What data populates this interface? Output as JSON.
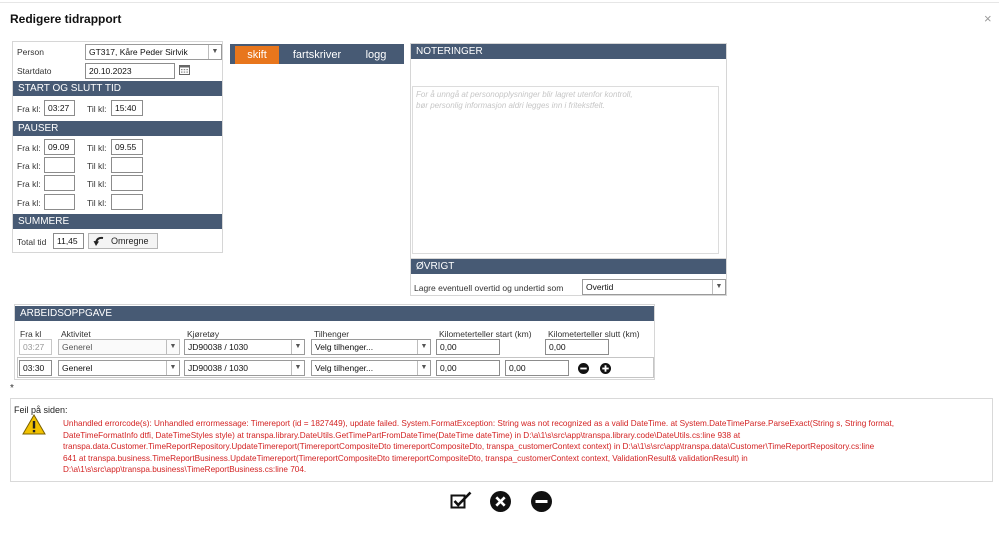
{
  "dialog": {
    "title": "Redigere tidrapport",
    "close_glyph": "×"
  },
  "person": {
    "label": "Person",
    "value": "GT317, Kåre Peder Sirlvik",
    "startdato_label": "Startdato",
    "startdato_value": "20.10.2023"
  },
  "start_slutt": {
    "header": "START OG SLUTT TID",
    "fra_label": "Fra kl:",
    "fra_value": "03:27",
    "til_label": "Til kl:",
    "til_value": "15:40"
  },
  "pauser": {
    "header": "PAUSER",
    "rows": [
      {
        "fra_label": "Fra kl:",
        "fra": "09.09",
        "til_label": "Til kl:",
        "til": "09.55"
      },
      {
        "fra_label": "Fra kl:",
        "fra": "",
        "til_label": "Til kl:",
        "til": ""
      },
      {
        "fra_label": "Fra kl:",
        "fra": "",
        "til_label": "Til kl:",
        "til": ""
      },
      {
        "fra_label": "Fra kl:",
        "fra": "",
        "til_label": "Til kl:",
        "til": ""
      }
    ]
  },
  "summere": {
    "header": "SUMMERE",
    "total_label": "Total tid",
    "total_value": "11,45",
    "omregne_label": "Omregne"
  },
  "tabs": [
    {
      "label": "skift",
      "active": true
    },
    {
      "label": "fartskriver",
      "active": false
    },
    {
      "label": "logg",
      "active": false
    }
  ],
  "noteringer": {
    "header": "NOTERINGER",
    "placeholder_line1": "For å unngå at personopplysninger blir lagret utenfor kontroll,",
    "placeholder_line2": "bør personlig informasjon aldri legges inn i fritekstfelt."
  },
  "ovrigt": {
    "header": "ØVRIGT",
    "label": "Lagre eventuell overtid og undertid som",
    "value": "Overtid"
  },
  "arbeid": {
    "header": "ARBEIDSOPPGAVE",
    "columns": [
      "Fra kl",
      "Aktivitet",
      "Kjøretøy",
      "Tilhenger",
      "Kilometerteller start (km)",
      "Kilometerteller slutt (km)"
    ],
    "row1": {
      "fra": "03:27",
      "aktivitet": "Generel",
      "kjoretoy": "JD90038 / 1030",
      "tilhenger": "Velg tilhenger...",
      "km_start": "0,00",
      "km_slutt": "0,00"
    },
    "row2": {
      "fra": "03:30",
      "aktivitet": "Generel",
      "kjoretoy": "JD90038 / 1030",
      "tilhenger": "Velg tilhenger...",
      "km_start": "0,00",
      "km_slutt": "0,00"
    }
  },
  "asterisk": "*",
  "error": {
    "title": "Feil på siden:",
    "lines": [
      "Unhandled errorcode(s): Unhandled errormessage: Timereport (id = 1827449), update failed. System.FormatException: String was not recognized as a valid DateTime. at System.DateTimeParse.ParseExact(String s, String format,",
      "DateTimeFormatInfo dtfi, DateTimeStyles style) at transpa.library.DateUtils.GetTimePartFromDateTime(DateTime dateTime) in D:\\a\\1\\s\\src\\app\\transpa.library.code\\DateUtils.cs:line 938 at",
      "transpa.data.Customer.TimeReportRepository.UpdateTimereport(TimereportCompositeDto timereportCompositeDto, transpa_customerContext context) in D:\\a\\1\\s\\src\\app\\transpa.data\\Customer\\TimeReportRepository.cs:line",
      "641 at transpa.business.TimeReportBusiness.UpdateTimereport(TimereportCompositeDto timereportCompositeDto, transpa_customerContext context, ValidationResult& validationResult) in",
      "D:\\a\\1\\s\\src\\app\\transpa.business\\TimeReportBusiness.cs:line 704."
    ]
  },
  "colors": {
    "header_bg": "#475a74",
    "tab_active": "#e8761c",
    "error_text": "#d32323"
  }
}
